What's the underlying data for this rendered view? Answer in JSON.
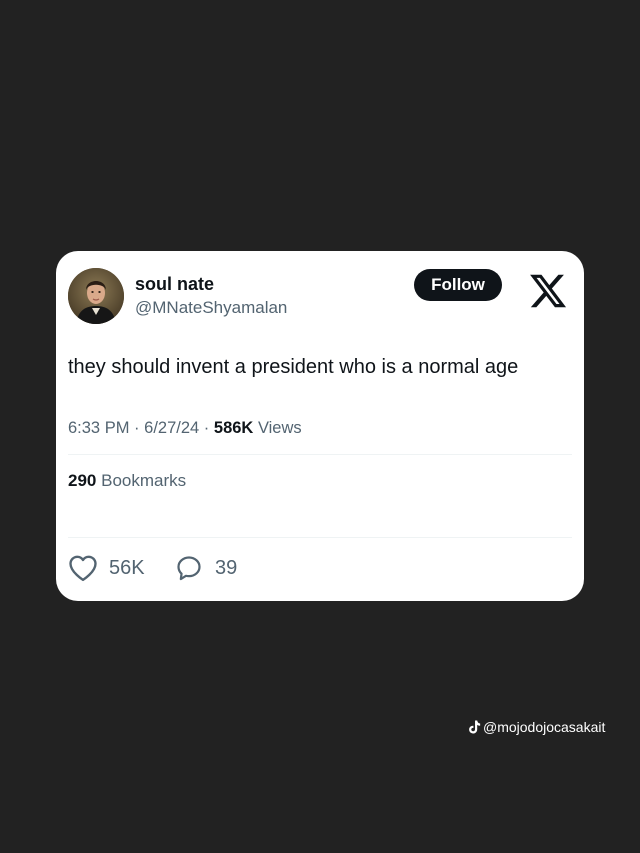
{
  "tweet": {
    "display_name": "soul nate",
    "handle": "@MNateShyamalan",
    "follow_label": "Follow",
    "text": "they should invent a president who is a normal age",
    "time": "6:33 PM",
    "date": "6/27/24",
    "separator": "·",
    "views_count": "586K",
    "views_label": "Views",
    "bookmarks_count": "290",
    "bookmarks_label": "Bookmarks",
    "likes": "56K",
    "replies": "39"
  },
  "icons": {
    "brand": "x-logo-icon",
    "like": "heart-icon",
    "reply": "speech-bubble-icon",
    "watermark": "tiktok-icon"
  },
  "colors": {
    "background": "#222222",
    "card": "#ffffff",
    "primary_text": "#0f1419",
    "secondary_text": "#536471"
  },
  "watermark": {
    "text": "@mojodojocasakait"
  }
}
